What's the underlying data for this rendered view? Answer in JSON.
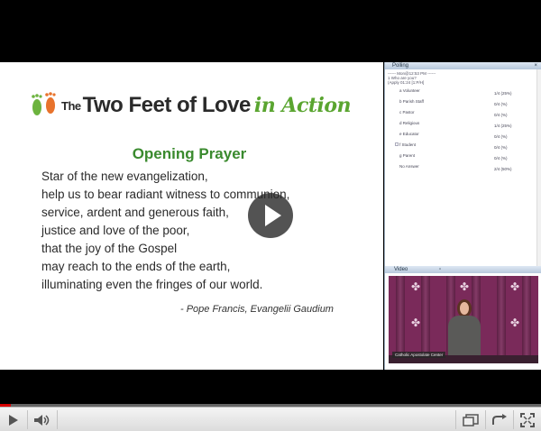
{
  "slide": {
    "logo": {
      "the": "The",
      "main": "Two Feet of Love",
      "accent": "in Action"
    },
    "title": "Opening Prayer",
    "lines": [
      "Star of the new evangelization,",
      "help us to bear radiant witness to communion,",
      "service, ardent and generous faith,",
      "justice and love of the poor,",
      "that the joy of the Gospel",
      "may reach to the ends of the earth,",
      "illuminating even the fringes of our world."
    ],
    "attribution": "- Pope Francis, Evangelii Gaudium"
  },
  "polling": {
    "header": "Polling",
    "meta": [
      "------ Mon@12:53 PM ------",
      "1 Who are you?",
      "(Apply 01:24 [1:P/H]"
    ],
    "options": [
      {
        "label": "a Volunteer",
        "count": "1/4 (25%)"
      },
      {
        "label": "b Parish Staff",
        "count": "0/4 (%)"
      },
      {
        "label": "c Pastor",
        "count": "0/4 (%)"
      },
      {
        "label": "d Religious",
        "count": "1/4 (25%)"
      },
      {
        "label": "e Educator",
        "count": "0/4 (%)"
      },
      {
        "label": "f Student",
        "count": "0/4 (%)"
      },
      {
        "label": "g Parent",
        "count": "0/4 (%)"
      },
      {
        "label": "No Answer",
        "count": "2/4 (50%)"
      }
    ]
  },
  "video_panel": {
    "header": "Video",
    "caption": "Catholic Apostolate Center"
  },
  "player": {
    "progress_fraction": 0.02
  },
  "colors": {
    "accent_green": "#3a8a2e",
    "progress_red": "#d80000"
  },
  "icons": {
    "play": "play-icon",
    "volume": "volume-icon",
    "popout": "popout-icon",
    "replay": "replay-icon",
    "fullscreen": "fullscreen-icon"
  }
}
